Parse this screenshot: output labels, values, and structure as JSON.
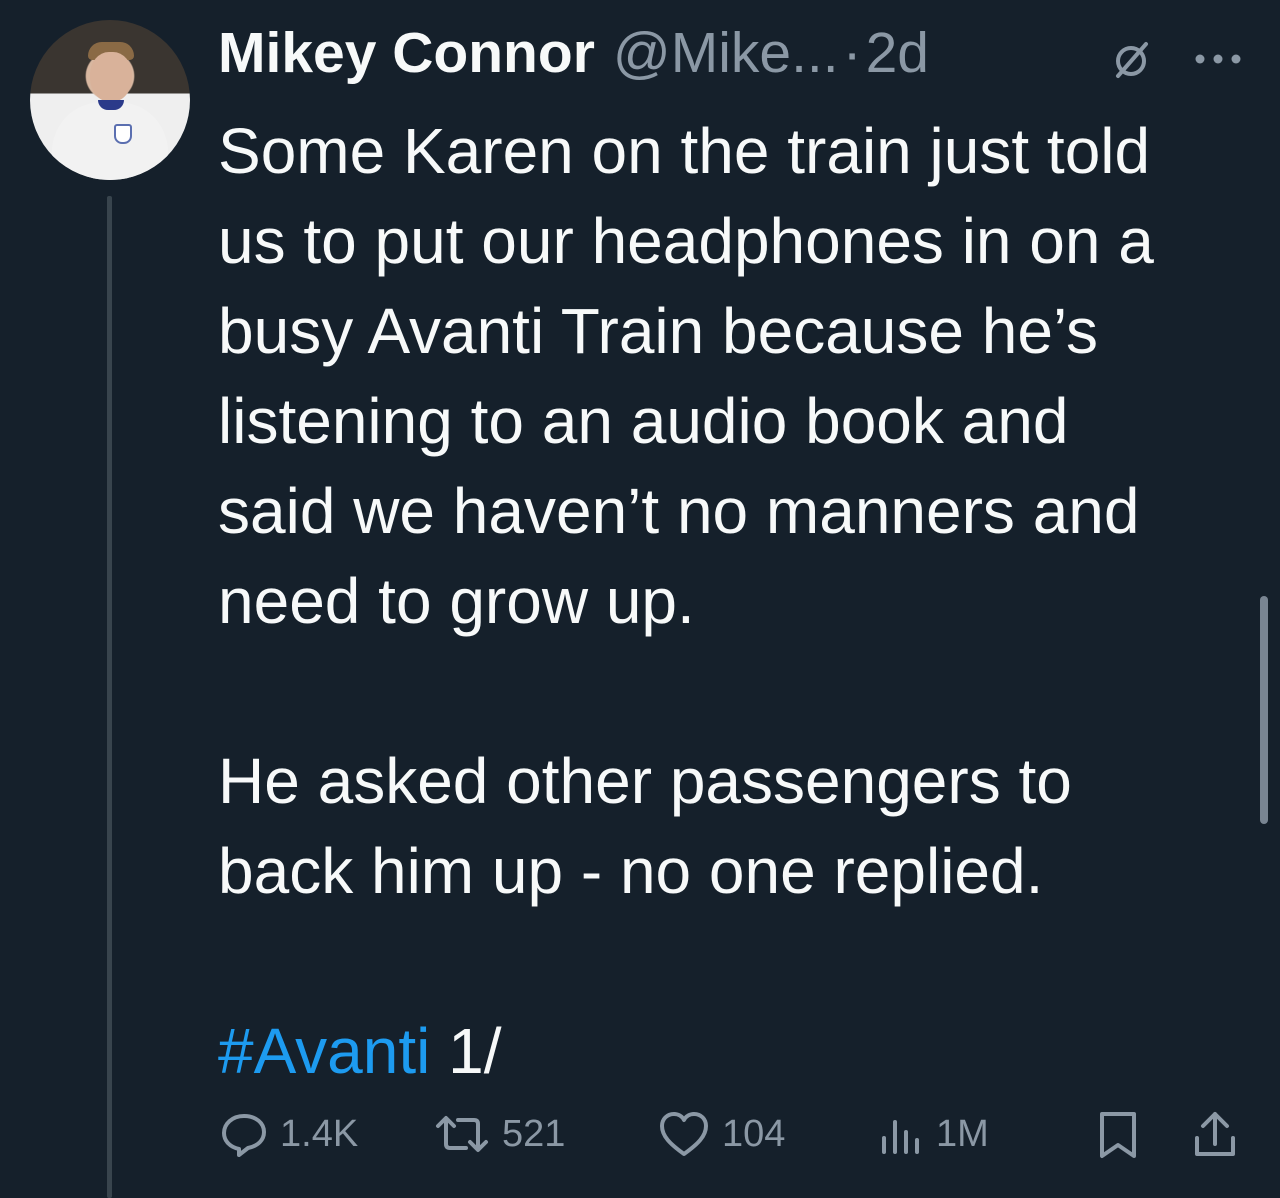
{
  "tweet": {
    "author_name": "Mikey Connor",
    "handle": "@Mike...",
    "separator": "·",
    "time": "2d",
    "text_main": "Some Karen on the train just told\nus to put our headphones in on a\nbusy Avanti Train because he’s\nlistening to an audio book and\nsaid we haven’t no manners and\nneed to grow up.\n\nHe asked other passengers to\nback him up - no one replied.\n\n",
    "hashtag": "#Avanti",
    "text_tail": " 1/",
    "icons": {
      "header_left": "no-symbol-icon",
      "header_right": "more-icon"
    }
  },
  "actions": {
    "reply_count": "1.4K",
    "retweet_count": "521",
    "like_count": "104",
    "views_count": "1M"
  },
  "colors": {
    "background": "#15202b",
    "text": "#f7f9f9",
    "muted": "#8b98a5",
    "accent": "#1d9bf0"
  }
}
